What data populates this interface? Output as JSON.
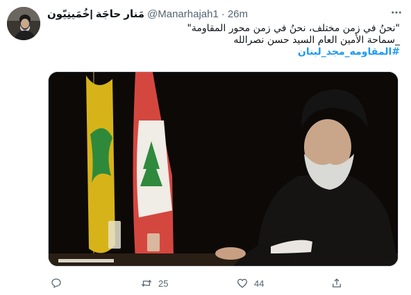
{
  "tweet": {
    "display_name": "مَنار حاجَة |خُمَينِيّون",
    "handle": "@Manarhajah1",
    "separator": "·",
    "time": "26m",
    "text_lines": [
      "\"نحنُ في زمن مختلف، نحنُ في زمن محور المقاومة\"",
      "_سماحة الأمين العام السيد حسن نصرالله"
    ],
    "hashtag": "#المقاومه_مجد_لبنان",
    "counts": {
      "replies": "",
      "retweets": "25",
      "likes": "44"
    }
  },
  "icons": {
    "more": "more-dots-icon",
    "reply": "reply-icon",
    "retweet": "retweet-icon",
    "like": "heart-icon",
    "share": "share-icon"
  },
  "colors": {
    "accent": "#1d9bf0",
    "secondary_text": "#536471",
    "primary_text": "#0f1419"
  }
}
